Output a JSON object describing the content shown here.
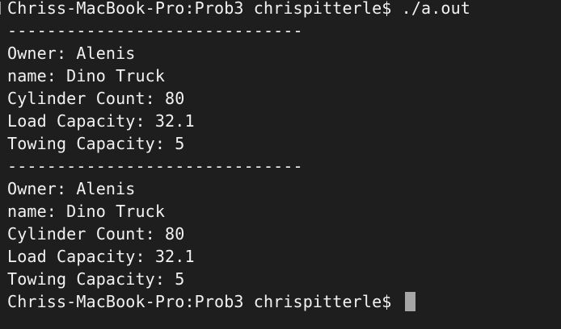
{
  "terminal": {
    "lines": [
      "Chriss-MacBook-Pro:Prob3 chrispitterle$ ./a.out",
      "------------------------------",
      "Owner: Alenis",
      "name: Dino Truck",
      "Cylinder Count: 80",
      "Load Capacity: 32.1",
      "Towing Capacity: 5",
      "------------------------------",
      "Owner: Alenis",
      "name: Dino Truck",
      "Cylinder Count: 80",
      "Load Capacity: 32.1",
      "Towing Capacity: 5"
    ],
    "prompt": "Chriss-MacBook-Pro:Prob3 chrispitterle$ "
  }
}
